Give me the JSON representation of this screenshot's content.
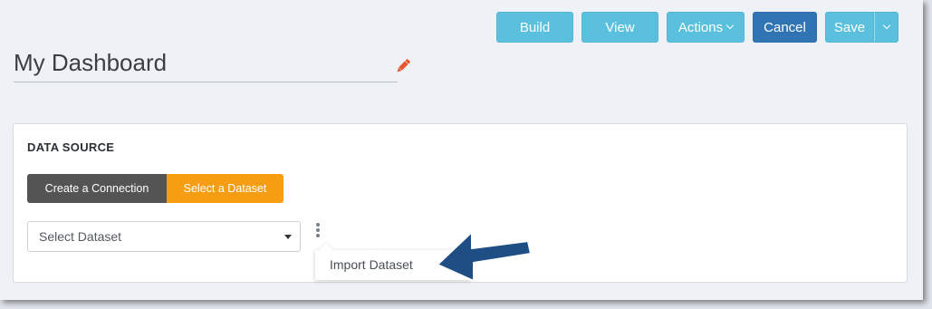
{
  "toolbar": {
    "build_label": "Build",
    "view_label": "View",
    "actions_label": "Actions",
    "cancel_label": "Cancel",
    "save_label": "Save"
  },
  "dashboard": {
    "title": "My Dashboard"
  },
  "data_source": {
    "heading": "DATA SOURCE",
    "create_connection_label": "Create a Connection",
    "select_dataset_label": "Select a Dataset",
    "dataset_select_value": "Select Dataset",
    "menu_items": [
      "Import Dataset"
    ]
  },
  "icons": {
    "edit": "pencil-icon",
    "more": "vertical-ellipsis-icon",
    "dropdown": "chevron-down-icon",
    "annotation": "arrow-pointer"
  },
  "colors": {
    "light_button": "#5bc0de",
    "primary_button": "#3174b4",
    "active_segment": "#f79d11",
    "inactive_segment": "#545454",
    "edit_icon": "#e8542b",
    "annotation_arrow": "#1f4e85"
  }
}
